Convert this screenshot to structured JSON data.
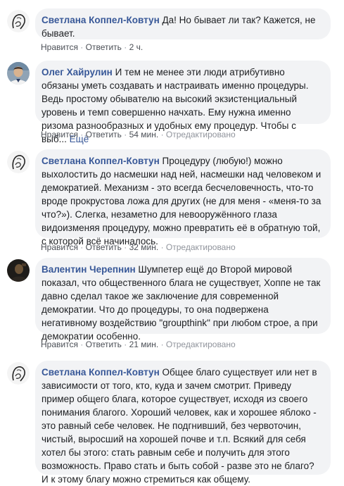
{
  "comments": [
    {
      "author": "Светлана Коппел-Ковтун",
      "text": "Да! Но бывает ли так? Кажется, не бывает.",
      "more": "",
      "like": "Нравится",
      "reply": "Ответить",
      "time": "2 ч.",
      "edited": ""
    },
    {
      "author": "Олег Хайрулин",
      "text": "И тем не менее эти люди атрибутивно обязаны уметь создавать и настраивать именно процедуры. Ведь простому обывателю на высокий экзистенциальный уровень и темп совершенно начхать. Ему нужна именно ризома разнообразных и удобных ему процедур. Чтобы с выб...",
      "more": "Ещё",
      "like": "Нравится",
      "reply": "Ответить",
      "time": "54 мин.",
      "edited": "Отредактировано"
    },
    {
      "author": "Светлана Коппел-Ковтун",
      "text": "Процедуру (любую!) можно выхолостить до насмешки над ней, насмешки над человеком и демократией. Механизм - это всегда бесчеловечность, что-то вроде прокрустова ложа для других (не для меня - «меня-то за что?»). Слегка, незаметно для невооружённого глаза видоизменяя процедуру, можно превратить её в обратную той, с которой всё начиналось.",
      "more": "",
      "like": "Нравится",
      "reply": "Ответить",
      "time": "32 мин.",
      "edited": "Отредактировано"
    },
    {
      "author": "Валентин Черепнин",
      "text": "Шумпетер ещё до Второй мировой показал, что общественного блага не существует, Хоппе не так давно сделал такое же заключение для современной демократии. Что до процедуры, то она подвержена негативному воздействию \"groupthink\" при любом строе, а при демократии особенно.",
      "more": "",
      "like": "Нравится",
      "reply": "Ответить",
      "time": "21 мин.",
      "edited": "Отредактировано"
    },
    {
      "author": "Светлана Коппел-Ковтун",
      "text": "Общее благо существует или нет в зависимости от того, кто, куда и зачем смотрит. Приведу пример общего блага, которое существует, исходя из своего понимания благого. Хороший человек, как и хорошее яблоко - это равный себе человек. Не подгнивший, без червоточин, чистый, выросший на хорошей почве и т.п. Всякий для себя хотел бы этого: стать равным себе и получить для этого возможность. Право стать и быть собой - разве это не благо? И к этому благу можно стремиться как общему.",
      "more": "",
      "like": "",
      "reply": "",
      "time": "",
      "edited": ""
    }
  ],
  "colors": {
    "author": "#385898",
    "bubble": "#f2f3f5",
    "meta": "#90949c"
  },
  "icons": [
    "sketch-portrait-avatar",
    "man-photo-avatar",
    "dark-photo-avatar"
  ]
}
